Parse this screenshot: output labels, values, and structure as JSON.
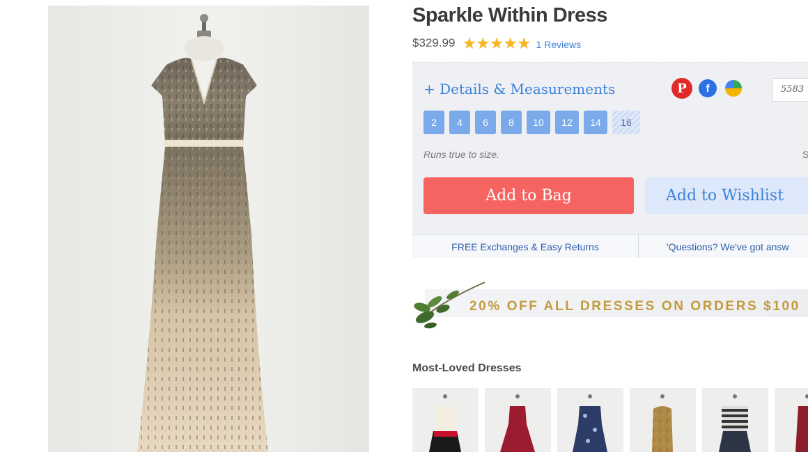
{
  "product": {
    "title": "Sparkle Within Dress",
    "price": "$329.99",
    "rating_stars": 5,
    "reviews_link": "1 Reviews"
  },
  "details": {
    "toggle_label": "+ Details & Measurements",
    "quantity_value": "5583",
    "fit_note": "Runs true to size.",
    "size_chart_partial": "S"
  },
  "sizes": [
    {
      "label": "2",
      "available": true
    },
    {
      "label": "4",
      "available": true
    },
    {
      "label": "6",
      "available": true
    },
    {
      "label": "8",
      "available": true
    },
    {
      "label": "10",
      "available": true
    },
    {
      "label": "12",
      "available": true
    },
    {
      "label": "14",
      "available": true
    },
    {
      "label": "16",
      "available": false
    }
  ],
  "actions": {
    "add_to_bag": "Add to Bag",
    "add_to_wishlist": "Add to Wishlist"
  },
  "info_bar": {
    "returns": "FREE Exchanges & Easy Returns",
    "questions": "'Questions? We've got answ"
  },
  "promo": {
    "text": "20% OFF ALL DRESSES ON ORDERS $100"
  },
  "most_loved": {
    "heading": "Most-Loved Dresses",
    "count_visible": 6
  },
  "social": [
    "pinterest-icon",
    "facebook-icon",
    "google-icon"
  ],
  "colors": {
    "accent_blue": "#3e82d8",
    "add_bag_red": "#f66462",
    "size_blue": "#7aaaea",
    "star_gold": "#f5b623",
    "promo_gold": "#c49a3a"
  }
}
